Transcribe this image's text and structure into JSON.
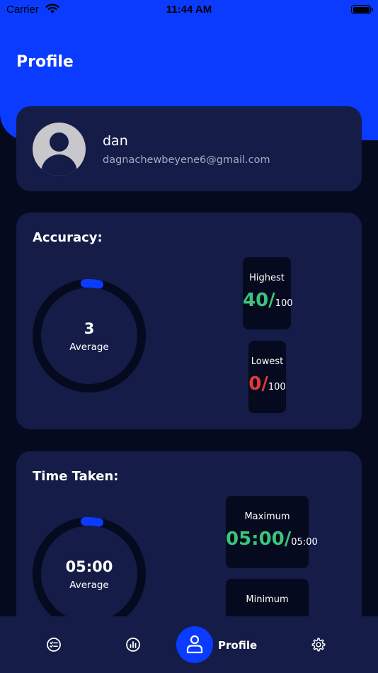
{
  "status_bar": {
    "carrier": "Carrier",
    "time": "11:44 AM"
  },
  "page": {
    "title": "Profile"
  },
  "profile": {
    "name": "dan",
    "email": "dagnachewbeyene6@gmail.com"
  },
  "accuracy": {
    "title": "Accuracy:",
    "average_value": "3",
    "average_label": "Average",
    "average_fraction": 0.03,
    "highest": {
      "label": "Highest",
      "value": "40/",
      "max": "100"
    },
    "lowest": {
      "label": "Lowest",
      "value": "0/",
      "max": "100"
    }
  },
  "time_taken": {
    "title": "Time Taken:",
    "average_value": "05:00",
    "average_label": "Average",
    "maximum": {
      "label": "Maximum",
      "value": "05:00/",
      "max": "05:00"
    },
    "minimum": {
      "label": "Minimum"
    }
  },
  "nav": {
    "active_label": "Profile",
    "items": [
      "quiz-list-icon",
      "chart-icon",
      "person-icon",
      "gear-icon"
    ]
  },
  "colors": {
    "accent": "#0a3bff",
    "card": "#141c47",
    "background": "#050a1f",
    "good": "#3cc47a",
    "bad": "#e53935"
  }
}
